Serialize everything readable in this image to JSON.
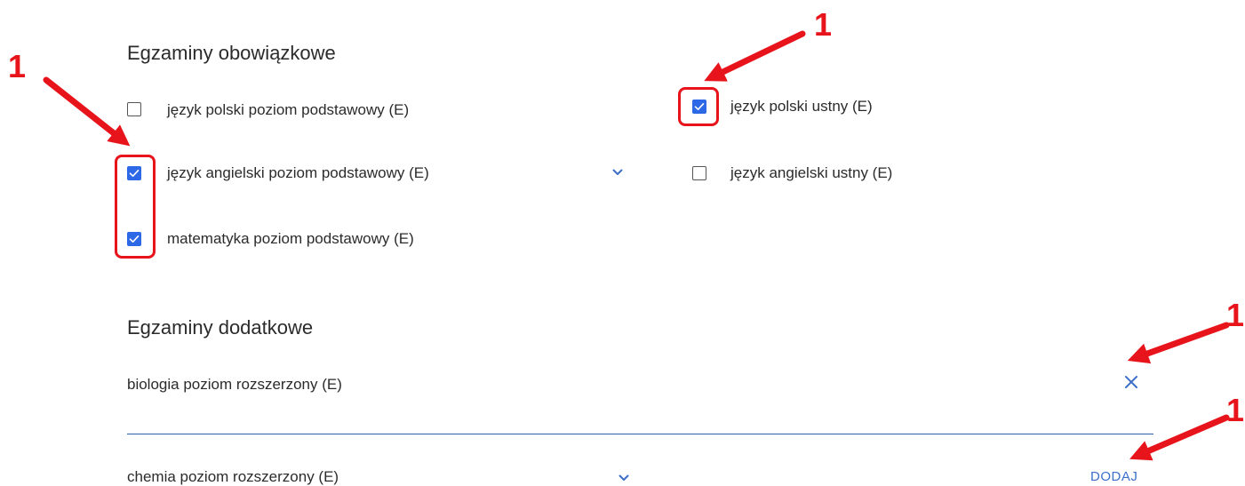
{
  "mandatory": {
    "title": "Egzaminy obowiązkowe",
    "left": [
      {
        "label": "język polski poziom podstawowy (E)",
        "checked": false
      },
      {
        "label": "język angielski poziom podstawowy (E)",
        "checked": true
      },
      {
        "label": "matematyka poziom podstawowy (E)",
        "checked": true
      }
    ],
    "right": [
      {
        "label": "język polski ustny (E)",
        "checked": true
      },
      {
        "label": "język angielski ustny (E)",
        "checked": false
      }
    ]
  },
  "additional": {
    "title": "Egzaminy dodatkowe",
    "selected_item": "biologia poziom rozszerzony (E)",
    "select_value": "chemia poziom rozszerzony (E)",
    "add_label": "DODAJ"
  },
  "annotations": {
    "marker": "1"
  },
  "colors": {
    "accent": "#2d68e6",
    "annotation": "#e8141b",
    "divider": "#2d5fa8"
  },
  "icons": [
    "check-icon",
    "chevron-down-icon",
    "close-icon"
  ]
}
